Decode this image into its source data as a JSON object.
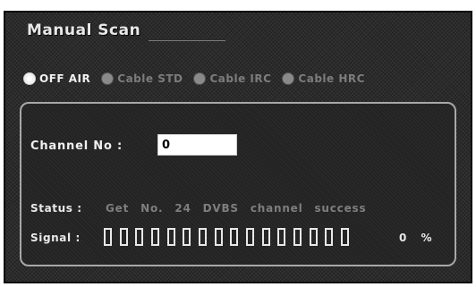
{
  "title": "Manual Scan",
  "modes": [
    {
      "label": "OFF AIR",
      "selected": true
    },
    {
      "label": "Cable STD",
      "selected": false
    },
    {
      "label": "Cable IRC",
      "selected": false
    },
    {
      "label": "Cable HRC",
      "selected": false
    }
  ],
  "channel": {
    "label": "Channel No :",
    "value": "0"
  },
  "status": {
    "label": "Status :",
    "text": "Get No. 24 DVBS channel success"
  },
  "signal": {
    "label": "Signal :",
    "segments": 16,
    "level": 0,
    "value_text": "0 %"
  },
  "colors": {
    "background": "#2b2b2b",
    "text": "#e8e8e8",
    "muted_text": "#7e7e7e",
    "panel_border": "#a8a8a8"
  }
}
